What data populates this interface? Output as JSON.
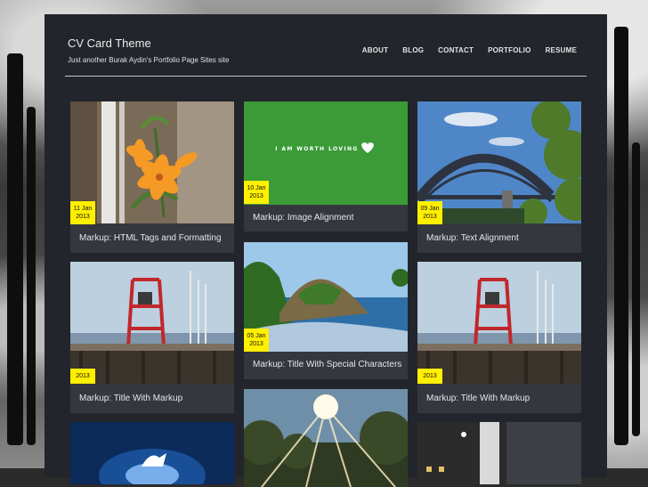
{
  "site": {
    "title": "CV Card Theme",
    "description": "Just another Burak Aydin's Portfolio Page Sites site"
  },
  "nav": {
    "items": [
      "ABOUT",
      "BLOG",
      "CONTACT",
      "PORTFOLIO",
      "RESUME"
    ]
  },
  "posts": [
    {
      "title": "Markup: HTML Tags and Formatting",
      "date_day": "11 Jan",
      "date_year": "2013",
      "image": "orange-lily-photo"
    },
    {
      "title": "Markup: Image Alignment",
      "date_day": "10 Jan",
      "date_year": "2013",
      "image": "i-am-worth-loving-banner",
      "banner_text": "I AM WORTH LOVING"
    },
    {
      "title": "Markup: Text Alignment",
      "date_day": "09 Jan",
      "date_year": "2013",
      "image": "harbour-bridge-photo"
    },
    {
      "title": "Markup: Title With Markup",
      "date_day": "",
      "date_year": "2013",
      "image": "pier-tower-photo"
    },
    {
      "title": "Markup: Title With Special Characters",
      "date_day": "05 Jan",
      "date_year": "2013",
      "image": "coastal-rock-photo"
    },
    {
      "title": "Markup: Title With Markup",
      "date_day": "",
      "date_year": "2013",
      "image": "pier-tower-photo"
    },
    {
      "title": "",
      "date_day": "",
      "date_year": "",
      "image": "unicorn-photo"
    },
    {
      "title": "",
      "date_day": "",
      "date_year": "",
      "image": "sunburst-forest-photo"
    },
    {
      "title": "",
      "date_day": "",
      "date_year": "",
      "image": "city-street-photo"
    }
  ],
  "colors": {
    "panel": "#22252b",
    "card": "#34373e",
    "date_badge": "#ffef00",
    "banner_green": "#3a9b37"
  }
}
